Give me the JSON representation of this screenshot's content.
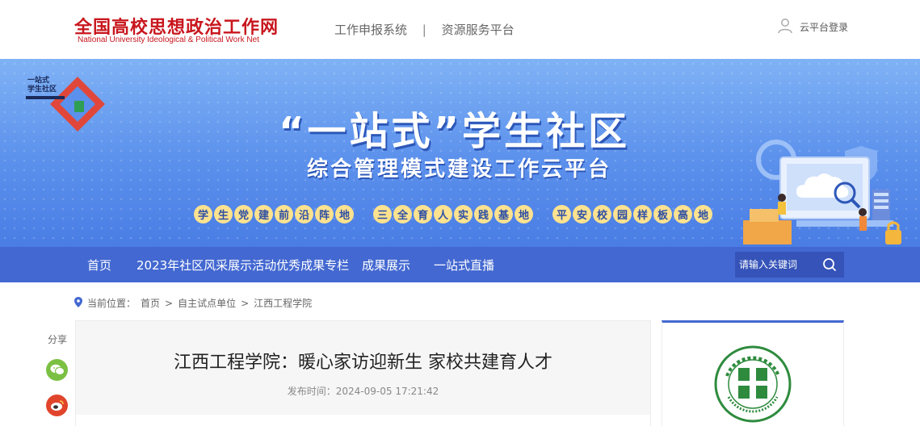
{
  "header": {
    "logo_cn": "全国高校思想政治工作网",
    "logo_en": "National University Ideological & Political Work Net",
    "top_links": [
      "工作申报系统",
      "资源服务平台"
    ],
    "separator": "|",
    "login": "云平台登录"
  },
  "banner": {
    "badge_line1": "一站式",
    "badge_line2": "学生社区",
    "title": "“一站式”学生社区",
    "subtitle": "综合管理模式建设工作云平台",
    "slogans": [
      [
        "学",
        "生",
        "党",
        "建",
        "前",
        "沿",
        "阵",
        "地"
      ],
      [
        "三",
        "全",
        "育",
        "人",
        "实",
        "践",
        "基",
        "地"
      ],
      [
        "平",
        "安",
        "校",
        "园",
        "样",
        "板",
        "高",
        "地"
      ]
    ]
  },
  "nav": {
    "items": [
      "首页",
      "2023年社区风采展示活动优秀成果专栏",
      "成果展示",
      "一站式直播"
    ],
    "search_placeholder": "请输入关键词"
  },
  "breadcrumb": {
    "label": "当前位置：",
    "items": [
      "首页",
      "自主试点单位",
      "江西工程学院"
    ],
    "sep": ">"
  },
  "share": {
    "label": "分享"
  },
  "article": {
    "title": "江西工程学院：暖心家访迎新生 家校共建育人才",
    "date": "发布时间：2024-09-05 17:21:42"
  },
  "icons": {
    "user": "user-icon",
    "search": "search-icon",
    "location": "location-pin-icon",
    "wechat": "wechat-icon",
    "weibo": "weibo-icon"
  },
  "colors": {
    "brand_red": "#c8161d",
    "nav_blue": "#4368d1",
    "wechat_green": "#7bc043",
    "weibo_red": "#e0452c",
    "slogan_yellow": "#fde28f",
    "seal_green": "#2e8b3e"
  }
}
